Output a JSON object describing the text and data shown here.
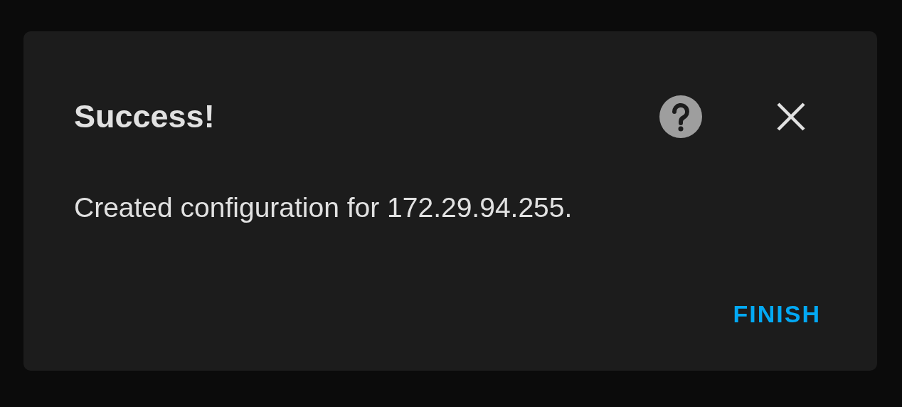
{
  "dialog": {
    "title": "Success!",
    "message": "Created configuration for 172.29.94.255.",
    "buttons": [
      {
        "label": "FINISH"
      }
    ]
  }
}
